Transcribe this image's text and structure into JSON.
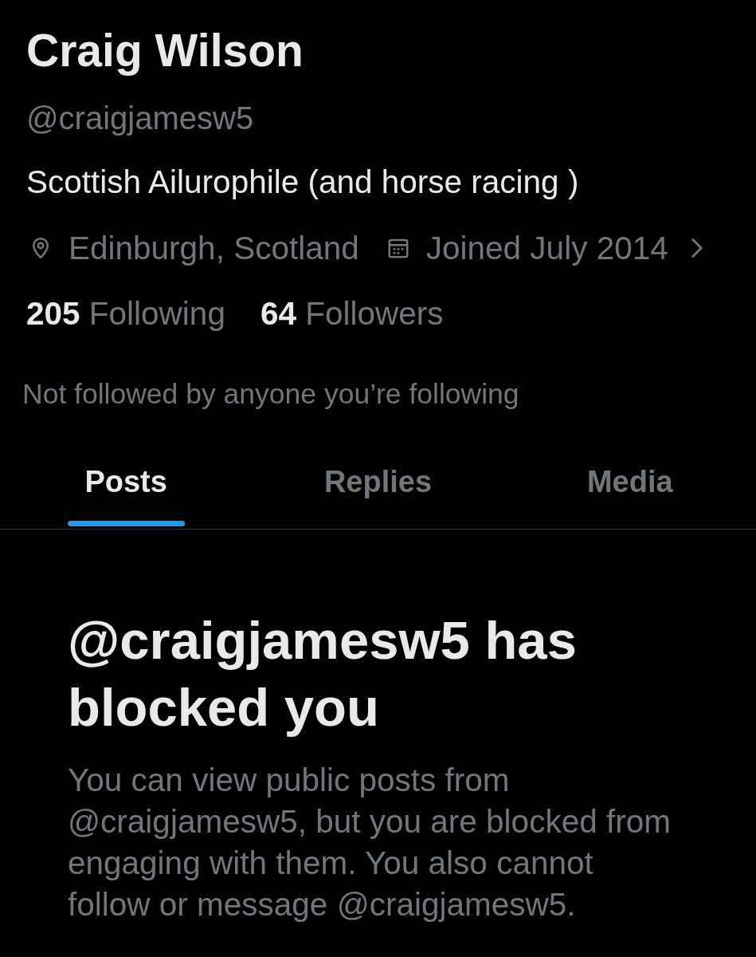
{
  "profile": {
    "name": "Craig Wilson",
    "handle": "@craigjamesw5",
    "bio": "Scottish Ailurophile (and horse racing )",
    "meta": [
      {
        "kind": "location",
        "text": "Edinburgh, Scotland"
      },
      {
        "kind": "joined",
        "text": "Joined July 2014"
      }
    ],
    "stats": [
      {
        "count": "205",
        "label": "Following"
      },
      {
        "count": "64",
        "label": "Followers"
      }
    ],
    "followed_by_note": "Not followed by anyone you’re following"
  },
  "tabs": [
    {
      "label": "Posts",
      "selected": true
    },
    {
      "label": "Replies",
      "selected": false
    },
    {
      "label": "Media",
      "selected": false
    }
  ],
  "blocked_notice": {
    "title": "@craigjamesw5 has blocked you",
    "message": "You can view public posts from @craigjamesw5, but you are blocked from engaging with them. You also cannot follow or message @craigjamesw5."
  }
}
